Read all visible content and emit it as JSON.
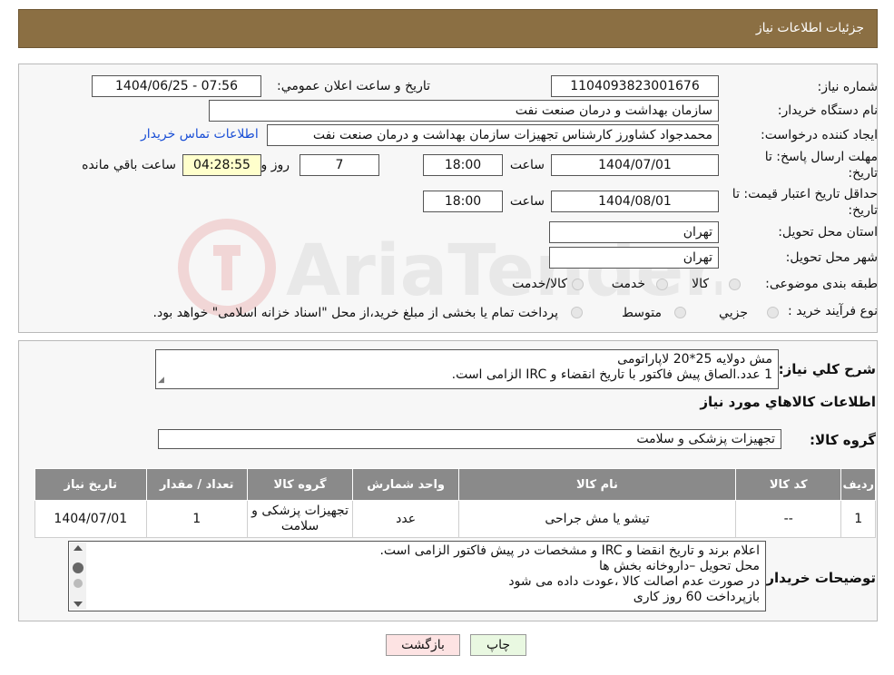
{
  "header": {
    "title": "جزئیات اطلاعات نیاز"
  },
  "form": {
    "need_number_label": "شماره نیاز:",
    "need_number": "1104093823001676",
    "announce_label": "تاريخ و ساعت اعلان عمومي:",
    "announce_value": "1404/06/25 - 07:56",
    "buyer_org_label": "نام دستگاه خريدار:",
    "buyer_org": "سازمان بهداشت و درمان صنعت نفت",
    "creator_label": "ايجاد کننده درخواست:",
    "creator": "محمدجواد کشاورز کارشناس تجهيزات سازمان بهداشت و درمان صنعت نفت",
    "contact_link": "اطلاعات تماس خريدار",
    "deadline_label_1": "مهلت ارسال پاسخ: تا",
    "deadline_label_2": "تاريخ:",
    "deadline_date": "1404/07/01",
    "time_label": "ساعت",
    "deadline_time": "18:00",
    "days_value": "7",
    "days_label": "روز و",
    "remaining_time": "04:28:55",
    "remaining_label": "ساعت باقي مانده",
    "validity_label_1": "حداقل تاريخ اعتبار قيمت: تا",
    "validity_label_2": "تاريخ:",
    "validity_date": "1404/08/01",
    "validity_time": "18:00",
    "province_label": "استان محل تحويل:",
    "province": "تهران",
    "city_label": "شهر محل تحويل:",
    "city": "تهران",
    "category_label": "طبقه بندی موضوعی:",
    "category_options": [
      "کالا",
      "خدمت",
      "کالا/خدمت"
    ],
    "process_label": "نوع فرآيند خريد :",
    "process_options": [
      "جزيي",
      "متوسط"
    ],
    "process_note": "پرداخت تمام يا بخشی از مبلغ خريد،از محل \"اسناد خزانه اسلامی\" خواهد بود."
  },
  "description": {
    "label": "شرح کلي نياز:",
    "line1": "مش دولایه 25*20 لاپاراتومی",
    "line2": "1 عدد.الصاق پیش فاکتور با تاریخ انقضاء و IRC الزامی است."
  },
  "items_section": {
    "title": "اطلاعات کالاهاي مورد نياز",
    "group_label": "گروه کالا:",
    "group_value": "تجهيزات پزشکی و سلامت",
    "columns": [
      "رديف",
      "کد کالا",
      "نام کالا",
      "واحد شمارش",
      "گروه کالا",
      "تعداد / مقدار",
      "تاريخ نياز"
    ],
    "rows": [
      [
        "1",
        "--",
        "تيشو يا مش جراحی",
        "عدد",
        "تجهيزات پزشکی و سلامت",
        "1",
        "1404/07/01"
      ]
    ]
  },
  "buyer_notes": {
    "label": "توضيحات خريدار:",
    "lines": [
      "اعلام برند و تاریخ انقضا  و IRC  و مشخصات در پیش فاکتور الزامی است.",
      "محل تحویل –داروخانه بخش ها",
      "در صورت عدم اصالت کالا ،عودت داده می شود",
      "بازپرداخت 60 روز کاری"
    ]
  },
  "buttons": {
    "print": "چاپ",
    "back": "بازگشت"
  },
  "colors": {
    "header": "#8b6f43",
    "table_header": "#8a8a8a",
    "link": "#1a4fd6",
    "print_btn": "#e9f8e1",
    "back_btn": "#fde3e3"
  }
}
